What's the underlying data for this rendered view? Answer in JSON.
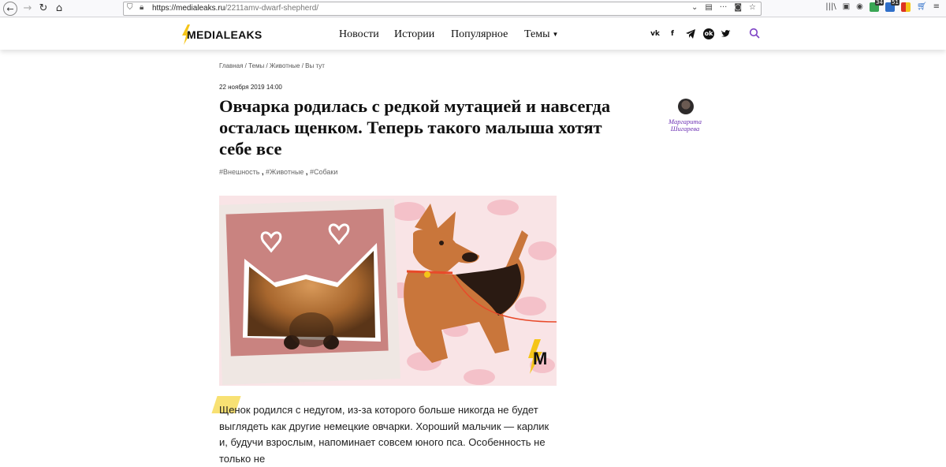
{
  "browser": {
    "url_host": "https://medialeaks.ru",
    "url_path": "/2211amv-dwarf-shepherd/",
    "ext_badge_1": "34",
    "ext_badge_2": "51"
  },
  "header": {
    "logo_text": "MEDIALEAKS",
    "nav": {
      "news": "Новости",
      "stories": "Истории",
      "popular": "Популярное",
      "themes": "Темы"
    },
    "social": [
      "vk",
      "f",
      "tg",
      "ok",
      "tw"
    ]
  },
  "article": {
    "breadcrumb": "Главная / Темы / Животные / Вы тут",
    "date": "22 ноября 2019 14:00",
    "title": "Овчарка родилась с редкой мутацией и навсегда осталась щенком. Теперь такого малыша хотят себе все",
    "tags": [
      "#Внешность",
      "#Животные",
      "#Собаки"
    ],
    "author": "Маргарита Шигарева",
    "body": "Щенок родился с недугом, из-за которого больше никогда не будет выглядеть как другие немецкие овчарки. Хороший мальчик — карлик и, будучи взрослым, напоминает совсем юного пса. Особенность не только не"
  },
  "colors": {
    "accent": "#7b3fc4",
    "author": "#6b2fb3",
    "logo_bolt": "#f5c518",
    "highlight": "#f7dc5a"
  }
}
